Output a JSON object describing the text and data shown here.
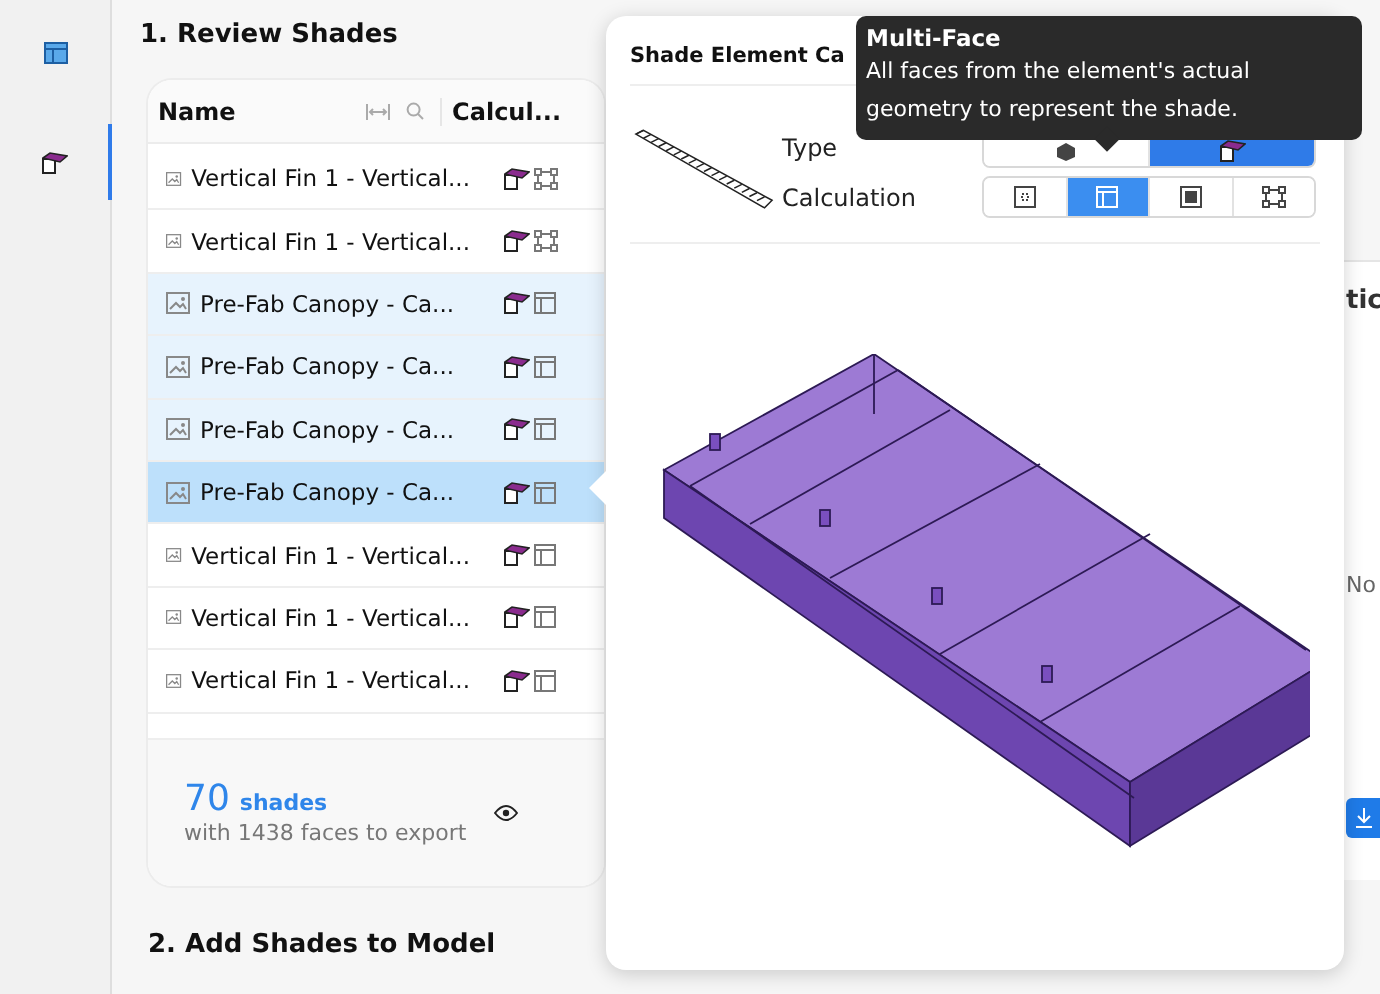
{
  "rail": {
    "items": [
      {
        "kind": "table",
        "selected": false
      },
      {
        "kind": "shade",
        "selected": true
      }
    ]
  },
  "section1": {
    "title": "1. Review Shades",
    "table": {
      "columns": [
        "Name",
        "Calcul..."
      ],
      "rows": [
        {
          "name": "Vertical Fin 1 - Vertical...",
          "calc": {
            "kind": "corners"
          },
          "selected": false,
          "highlighted": false
        },
        {
          "name": "Vertical Fin 1 - Vertical...",
          "calc": {
            "kind": "corners"
          },
          "selected": false,
          "highlighted": false
        },
        {
          "name": "Pre-Fab Canopy - Ca...",
          "calc": {
            "kind": "panel"
          },
          "selected": false,
          "highlighted": true
        },
        {
          "name": "Pre-Fab Canopy - Ca...",
          "calc": {
            "kind": "panel"
          },
          "selected": false,
          "highlighted": true
        },
        {
          "name": "Pre-Fab Canopy - Ca...",
          "calc": {
            "kind": "panel"
          },
          "selected": false,
          "highlighted": true
        },
        {
          "name": "Pre-Fab Canopy - Ca...",
          "calc": {
            "kind": "panel"
          },
          "selected": true,
          "highlighted": true
        },
        {
          "name": "Vertical Fin 1 - Vertical...",
          "calc": {
            "kind": "panel"
          },
          "selected": false,
          "highlighted": false
        },
        {
          "name": "Vertical Fin 1 - Vertical...",
          "calc": {
            "kind": "panel"
          },
          "selected": false,
          "highlighted": false
        },
        {
          "name": "Vertical Fin 1 - Vertical...",
          "calc": {
            "kind": "panel"
          },
          "selected": false,
          "highlighted": false
        }
      ]
    },
    "footer": {
      "count": "70",
      "unit": "shades",
      "detail": "with 1438 faces to export"
    }
  },
  "section2": {
    "title": "2. Add Shades to Model"
  },
  "right_panel": {
    "heading": "tic",
    "text": "No"
  },
  "popover": {
    "title": "Shade Element Ca",
    "type": {
      "label": "Type",
      "options": [
        {
          "kind": "solid",
          "selected": false
        },
        {
          "kind": "shade",
          "selected": true
        }
      ]
    },
    "calculation": {
      "label": "Calculation",
      "options": [
        {
          "kind": "dotted",
          "selected": false
        },
        {
          "kind": "panel",
          "selected": true
        },
        {
          "kind": "framed",
          "selected": false
        },
        {
          "kind": "corners",
          "selected": false
        }
      ]
    }
  },
  "tooltip": {
    "title": "Multi-Face",
    "text": "All faces from the element's actual geometry to represent the shade."
  }
}
